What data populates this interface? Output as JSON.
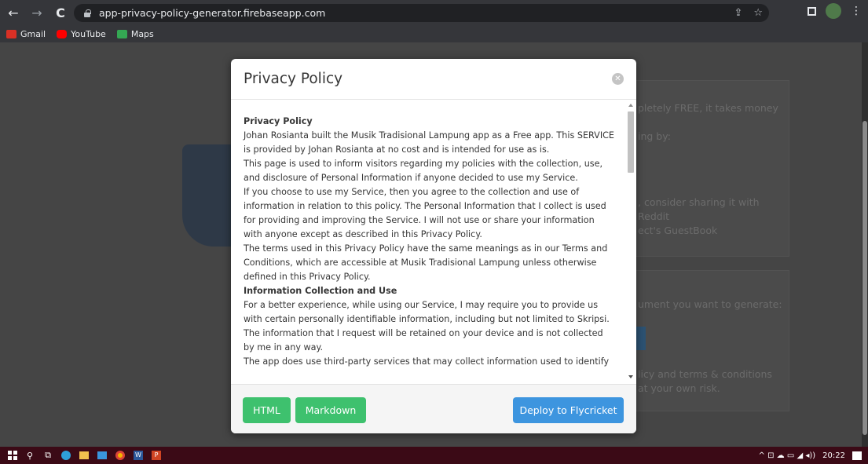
{
  "browser": {
    "back": "←",
    "forward": "→",
    "reload": "C",
    "url": "app-privacy-policy-generator.firebaseapp.com",
    "share_icon": "⇪",
    "star_icon": "☆",
    "more_icon": "⋮"
  },
  "bookmarks": [
    {
      "label": "Gmail",
      "color": "#d93025"
    },
    {
      "label": "YouTube",
      "color": "#ff0000"
    },
    {
      "label": "Maps",
      "color": "#34a853"
    }
  ],
  "background_page": {
    "lines": [
      "pletely FREE, it takes money",
      "ing by:",
      ", consider sharing it with",
      "Reddit",
      "ect's GuestBook",
      "ument you want to generate:",
      "licy and terms & conditions",
      "at your own risk."
    ]
  },
  "modal": {
    "title": "Privacy Policy",
    "close_icon": "✕",
    "sections": [
      {
        "heading": "Privacy Policy",
        "paragraphs": [
          "Johan Rosianta built the Musik Tradisional Lampung app as a Free app. This SERVICE is provided by Johan Rosianta at no cost and is intended for use as is.",
          "This page is used to inform visitors regarding my policies with the collection, use, and disclosure of Personal Information if anyone decided to use my Service.",
          "If you choose to use my Service, then you agree to the collection and use of information in relation to this policy. The Personal Information that I collect is used for providing and improving the Service. I will not use or share your information with anyone except as described in this Privacy Policy.",
          "The terms used in this Privacy Policy have the same meanings as in our Terms and Conditions, which are accessible at Musik Tradisional Lampung unless otherwise defined in this Privacy Policy."
        ]
      },
      {
        "heading": "Information Collection and Use",
        "paragraphs": [
          "For a better experience, while using our Service, I may require you to provide us with certain personally identifiable information, including but not limited to Skripsi. The information that I request will be retained on your device and is not collected by me in any way.",
          "The app does use third-party services that may collect information used to identify"
        ]
      }
    ],
    "buttons": {
      "html": "HTML",
      "markdown": "Markdown",
      "deploy": "Deploy to Flycricket"
    }
  },
  "taskbar": {
    "time": "20:22",
    "tray_icons": "^ ⊡ ☁ ▭ ◢ ◂))"
  },
  "colors": {
    "green": "#3ec16e",
    "blue": "#3d95df",
    "taskbar": "#3b0a16"
  }
}
